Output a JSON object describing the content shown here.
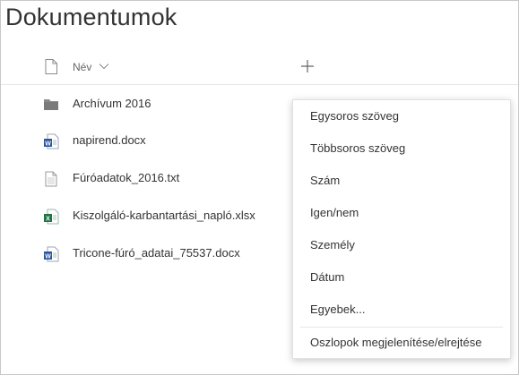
{
  "page": {
    "title": "Dokumentumok"
  },
  "header": {
    "name_column": "Név"
  },
  "files": [
    {
      "name": "Archívum 2016",
      "type": "folder"
    },
    {
      "name": "napirend.docx",
      "type": "word"
    },
    {
      "name": "Fúróadatok_2016.txt",
      "type": "text"
    },
    {
      "name": "Kiszolgáló-karbantartási_napló.xlsx",
      "type": "excel"
    },
    {
      "name": "Tricone-fúró_adatai_75537.docx",
      "type": "word"
    }
  ],
  "add_column_menu": {
    "items": [
      "Egysoros szöveg",
      "Többsoros szöveg",
      "Szám",
      "Igen/nem",
      "Személy",
      "Dátum",
      "Egyebek..."
    ],
    "footer_item": "Oszlopok megjelenítése/elrejtése"
  },
  "colors": {
    "word": "#2b579a",
    "excel": "#217346",
    "folder": "#8a8a8a",
    "text_icon": "#bdbdbd"
  }
}
